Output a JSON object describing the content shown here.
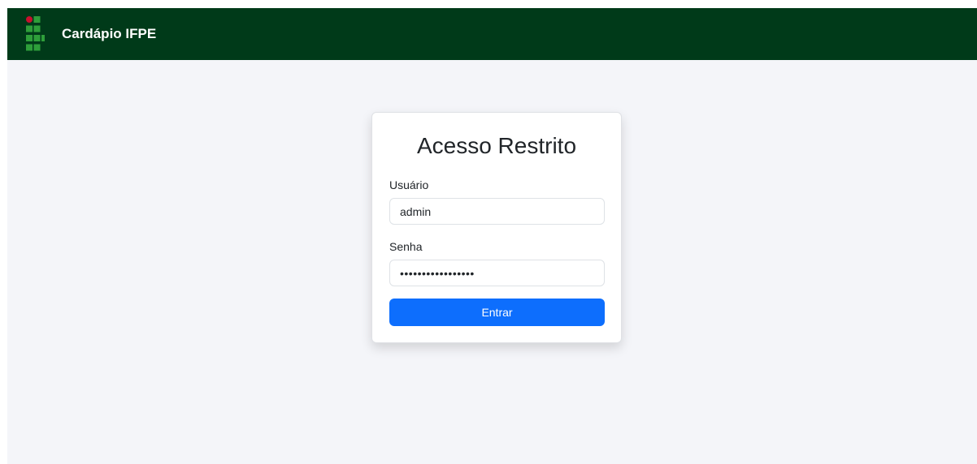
{
  "navbar": {
    "brand": "Cardápio IFPE",
    "logo_icon": "ifpe-logo-icon",
    "background_color": "#003a19"
  },
  "login": {
    "title": "Acesso Restrito",
    "username_label": "Usuário",
    "username_value": "admin",
    "password_label": "Senha",
    "password_value": "admin_password_xx",
    "submit_label": "Entrar",
    "button_color": "#0d6efd"
  },
  "colors": {
    "page_background": "#f4f5f9",
    "logo_red": "#c8102e",
    "logo_green": "#2e9e3a"
  }
}
